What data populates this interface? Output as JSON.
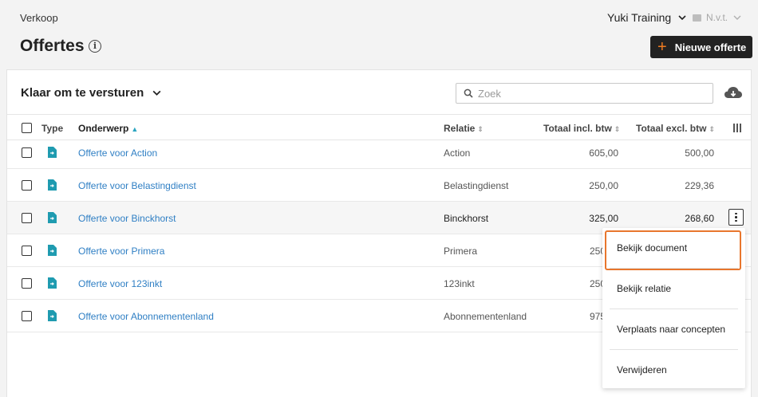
{
  "header": {
    "breadcrumb": "Verkoop",
    "company": "Yuki Training",
    "administration": "N.v.t.",
    "title": "Offertes",
    "new_button": "Nieuwe offerte"
  },
  "toolbar": {
    "filter_label": "Klaar om te versturen",
    "search_placeholder": "Zoek",
    "search_value": ""
  },
  "table": {
    "columns": {
      "type": "Type",
      "subject": "Onderwerp",
      "relation": "Relatie",
      "total_incl": "Totaal incl. btw",
      "total_excl": "Totaal excl. btw"
    },
    "sorted_column": "Onderwerp",
    "rows": [
      {
        "subject": "Offerte voor Action",
        "relation": "Action",
        "incl": "605,00",
        "excl": "500,00"
      },
      {
        "subject": "Offerte voor Belastingdienst",
        "relation": "Belastingdienst",
        "incl": "250,00",
        "excl": "229,36"
      },
      {
        "subject": "Offerte voor Binckhorst",
        "relation": "Binckhorst",
        "incl": "325,00",
        "excl": "268,60"
      },
      {
        "subject": "Offerte voor Primera",
        "relation": "Primera",
        "incl": "250",
        "excl": ""
      },
      {
        "subject": "Offerte voor 123inkt",
        "relation": "123inkt",
        "incl": "250",
        "excl": ""
      },
      {
        "subject": "Offerte voor Abonnementenland",
        "relation": "Abonnementenland",
        "incl": "975",
        "excl": ""
      }
    ]
  },
  "context_menu": {
    "items": [
      "Bekijk document",
      "Bekijk relatie",
      "Verplaats naar concepten",
      "Verwijderen"
    ],
    "highlighted": "Bekijk document"
  },
  "colors": {
    "accent": "#e8762d",
    "link": "#2f7fc4",
    "doc_icon": "#1f9bb0",
    "button_bg": "#222222"
  },
  "icons": {
    "info": "info-icon",
    "plus": "plus-icon",
    "search": "search-icon",
    "download": "cloud-download-icon",
    "document": "document-icon",
    "columns": "columns-icon",
    "more": "more-vertical-icon"
  }
}
